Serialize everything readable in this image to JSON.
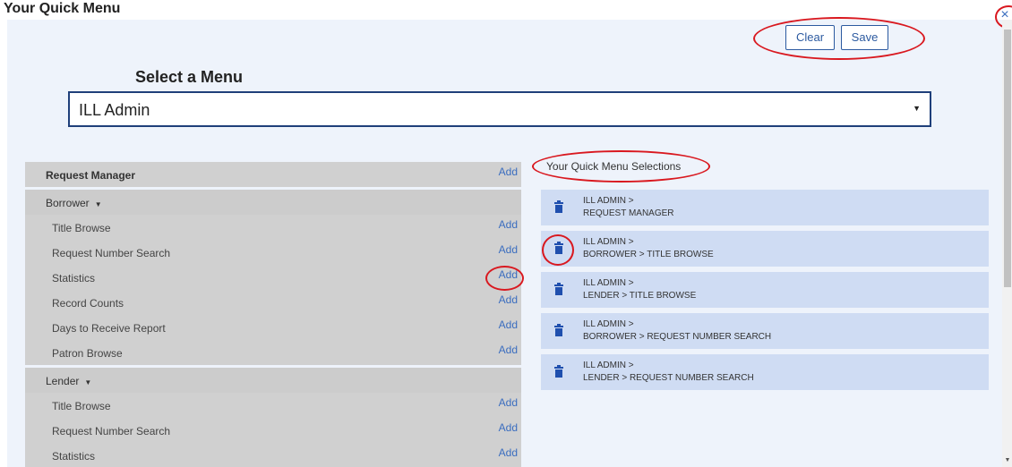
{
  "window": {
    "title": "Your Quick Menu",
    "close_glyph": "×"
  },
  "toolbar": {
    "clear_label": "Clear",
    "save_label": "Save"
  },
  "select": {
    "label": "Select a Menu",
    "value": "ILL Admin",
    "caret": "▼"
  },
  "menu": {
    "add_label": "Add",
    "items": [
      {
        "label": "Request Manager",
        "kind": "top"
      },
      {
        "label": "Borrower",
        "kind": "group"
      },
      {
        "label": "Title Browse",
        "kind": "child"
      },
      {
        "label": "Request Number Search",
        "kind": "child"
      },
      {
        "label": "Statistics",
        "kind": "child"
      },
      {
        "label": "Record Counts",
        "kind": "child"
      },
      {
        "label": "Days to Receive Report",
        "kind": "child"
      },
      {
        "label": "Patron Browse",
        "kind": "child"
      },
      {
        "label": "Lender",
        "kind": "group"
      },
      {
        "label": "Title Browse",
        "kind": "child"
      },
      {
        "label": "Request Number Search",
        "kind": "child"
      },
      {
        "label": "Statistics",
        "kind": "child"
      }
    ]
  },
  "selections": {
    "heading": "Your Quick Menu Selections",
    "items": [
      {
        "line1": "ILL ADMIN >",
        "line2": "REQUEST MANAGER"
      },
      {
        "line1": "ILL ADMIN >",
        "line2": "BORROWER > TITLE BROWSE"
      },
      {
        "line1": "ILL ADMIN >",
        "line2": "LENDER > TITLE BROWSE"
      },
      {
        "line1": "ILL ADMIN >",
        "line2": "BORROWER > REQUEST NUMBER SEARCH"
      },
      {
        "line1": "ILL ADMIN >",
        "line2": "LENDER > REQUEST NUMBER SEARCH"
      }
    ]
  },
  "colors": {
    "accent": "#2c5aa0",
    "highlight": "#d9181f",
    "selection_bg": "#cfdcf3",
    "menu_bg": "#d0d0d0"
  }
}
